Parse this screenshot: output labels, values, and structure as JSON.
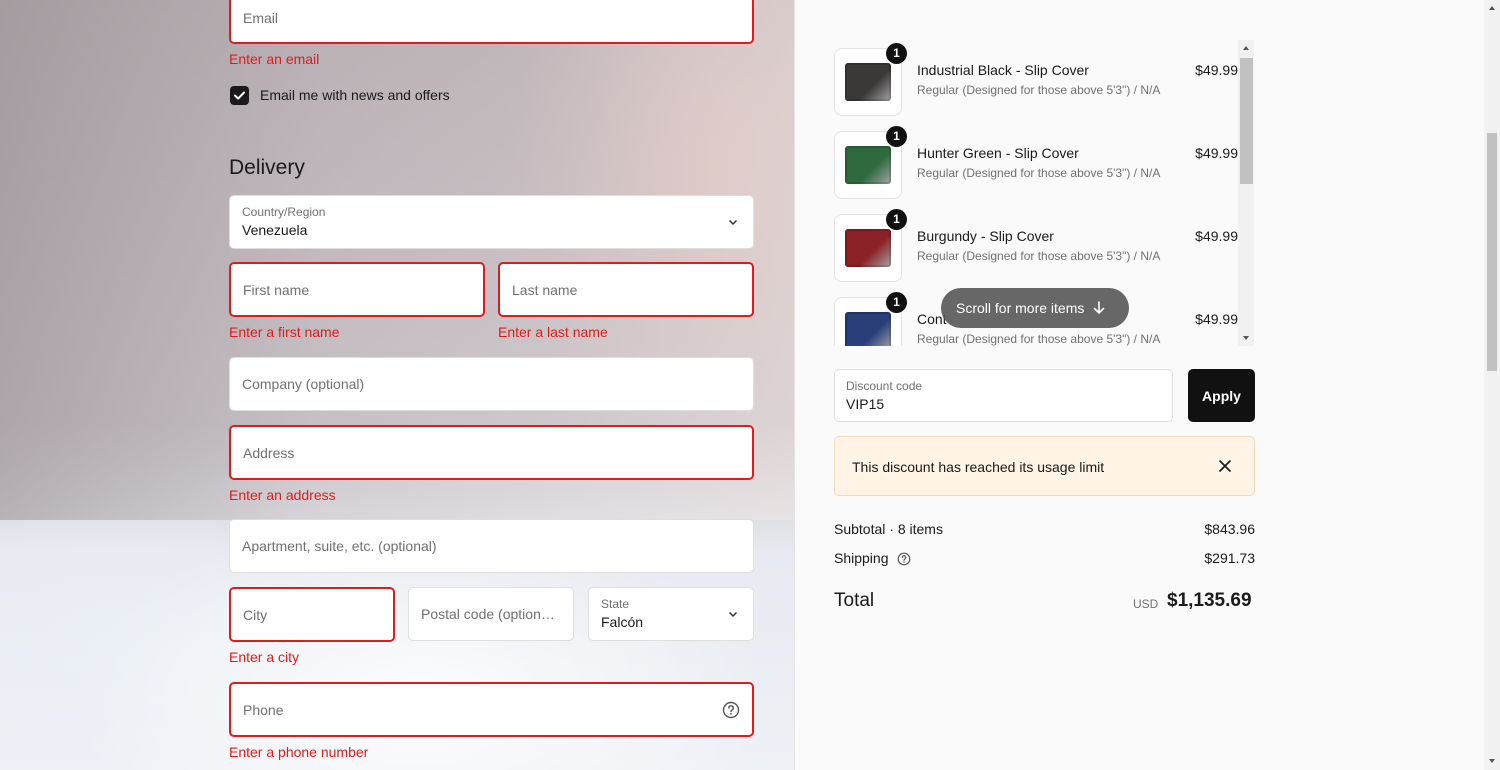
{
  "contact": {
    "email_placeholder": "Email",
    "email_error": "Enter an email",
    "newsletter_label": "Email me with news and offers",
    "newsletter_checked": true
  },
  "delivery": {
    "title": "Delivery",
    "country_label": "Country/Region",
    "country_value": "Venezuela",
    "first_name_placeholder": "First name",
    "first_name_error": "Enter a first name",
    "last_name_placeholder": "Last name",
    "last_name_error": "Enter a last name",
    "company_placeholder": "Company (optional)",
    "address_placeholder": "Address",
    "address_error": "Enter an address",
    "apartment_placeholder": "Apartment, suite, etc. (optional)",
    "city_placeholder": "City",
    "city_error": "Enter a city",
    "postal_placeholder": "Postal code (option…",
    "state_label": "State",
    "state_value": "Falcón",
    "phone_placeholder": "Phone",
    "phone_error": "Enter a phone number"
  },
  "cart": {
    "items": [
      {
        "name": "Industrial Black - Slip Cover",
        "variant": "Regular (Designed for those above 5'3\") / N/A",
        "price": "$49.99",
        "qty": "1",
        "color": "#3b3838"
      },
      {
        "name": "Hunter Green - Slip Cover",
        "variant": "Regular (Designed for those above 5'3\") / N/A",
        "price": "$49.99",
        "qty": "1",
        "color": "#2f6a3f"
      },
      {
        "name": "Burgundy - Slip Cover",
        "variant": "Regular (Designed for those above 5'3\") / N/A",
        "price": "$49.99",
        "qty": "1",
        "color": "#8b2227"
      },
      {
        "name": "Cont",
        "variant": "Regular (Designed for those above 5'3\") / N/A",
        "price": "$49.99",
        "qty": "1",
        "color": "#2a3f7a"
      }
    ],
    "scroll_hint": "Scroll for more items",
    "discount_label": "Discount code",
    "discount_value": "VIP15",
    "apply_label": "Apply",
    "notice": "This discount has reached its usage limit"
  },
  "summary": {
    "subtotal_label": "Subtotal · 8 items",
    "subtotal_value": "$843.96",
    "shipping_label": "Shipping",
    "shipping_value": "$291.73",
    "total_label": "Total",
    "currency": "USD",
    "total_value": "$1,135.69"
  },
  "colors": {
    "error": "#dd1d1d",
    "primary_button": "#111111",
    "notice_bg": "#fff4e6"
  }
}
